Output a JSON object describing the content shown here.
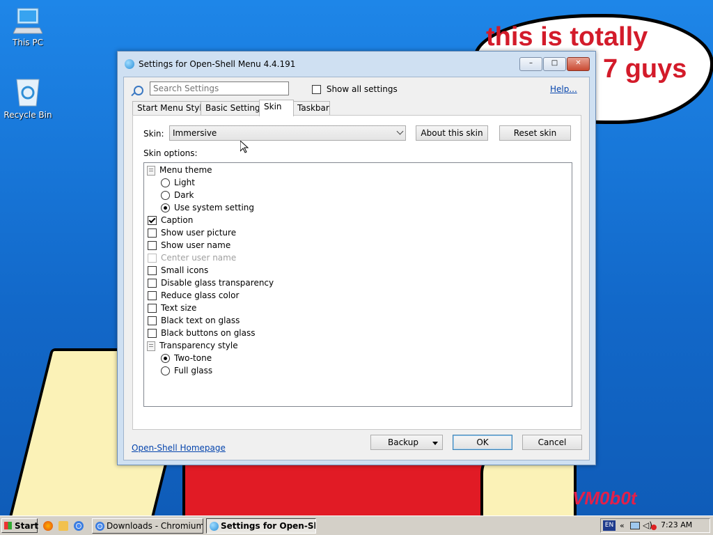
{
  "desktop": {
    "icons": [
      {
        "label": "This PC",
        "icon": "computer-icon"
      },
      {
        "label": "Recycle Bin",
        "icon": "recycle-bin-icon"
      }
    ],
    "bubble_line1": "this is totally",
    "bubble_line2": "7 guys",
    "signature": "VM0b0t"
  },
  "window": {
    "title": "Settings for Open-Shell Menu 4.4.191",
    "controls": {
      "minimize": "–",
      "maximize": "□",
      "close": "✕"
    },
    "search_placeholder": "Search Settings",
    "show_all_label": "Show all settings",
    "show_all_checked": false,
    "help_label": "Help...",
    "tabs": [
      {
        "label": "Start Menu Style",
        "active": false
      },
      {
        "label": "Basic Settings",
        "active": false
      },
      {
        "label": "Skin",
        "active": true
      },
      {
        "label": "Taskbar",
        "active": false
      }
    ],
    "skin_label": "Skin:",
    "skin_value": "Immersive",
    "about_skin_label": "About this skin",
    "reset_skin_label": "Reset skin",
    "skin_options_label": "Skin options:",
    "options": [
      {
        "label": "Menu theme",
        "kind": "group"
      },
      {
        "label": "Light",
        "kind": "radio",
        "checked": false
      },
      {
        "label": "Dark",
        "kind": "radio",
        "checked": false
      },
      {
        "label": "Use system setting",
        "kind": "radio",
        "checked": true
      },
      {
        "label": "Caption",
        "kind": "check",
        "checked": true
      },
      {
        "label": "Show user picture",
        "kind": "check",
        "checked": false
      },
      {
        "label": "Show user name",
        "kind": "check",
        "checked": false
      },
      {
        "label": "Center user name",
        "kind": "check",
        "checked": false,
        "disabled": true
      },
      {
        "label": "Small icons",
        "kind": "check",
        "checked": false
      },
      {
        "label": "Disable glass transparency",
        "kind": "check",
        "checked": false
      },
      {
        "label": "Reduce glass color",
        "kind": "check",
        "checked": false
      },
      {
        "label": "Text size",
        "kind": "check",
        "checked": false
      },
      {
        "label": "Black text on glass",
        "kind": "check",
        "checked": false
      },
      {
        "label": "Black buttons on glass",
        "kind": "check",
        "checked": false
      },
      {
        "label": "Transparency style",
        "kind": "group"
      },
      {
        "label": "Two-tone",
        "kind": "radio",
        "checked": true
      },
      {
        "label": "Full glass",
        "kind": "radio",
        "checked": false
      }
    ],
    "homepage_label": "Open-Shell Homepage",
    "backup_label": "Backup",
    "ok_label": "OK",
    "cancel_label": "Cancel"
  },
  "taskbar": {
    "start_label": "Start",
    "quick_launch": [
      "firefox-icon",
      "folder-icon",
      "chrome-icon"
    ],
    "tasks": [
      {
        "label": "Downloads - Chromium",
        "active": false,
        "icon": "chromium-icon"
      },
      {
        "label": "Settings for Open-Sh...",
        "active": true,
        "icon": "open-shell-icon"
      }
    ],
    "language": "EN",
    "tray_icons": [
      "chevron-left-icon",
      "network-icon",
      "volume-icon",
      "security-icon"
    ],
    "time": "7:23 AM"
  }
}
